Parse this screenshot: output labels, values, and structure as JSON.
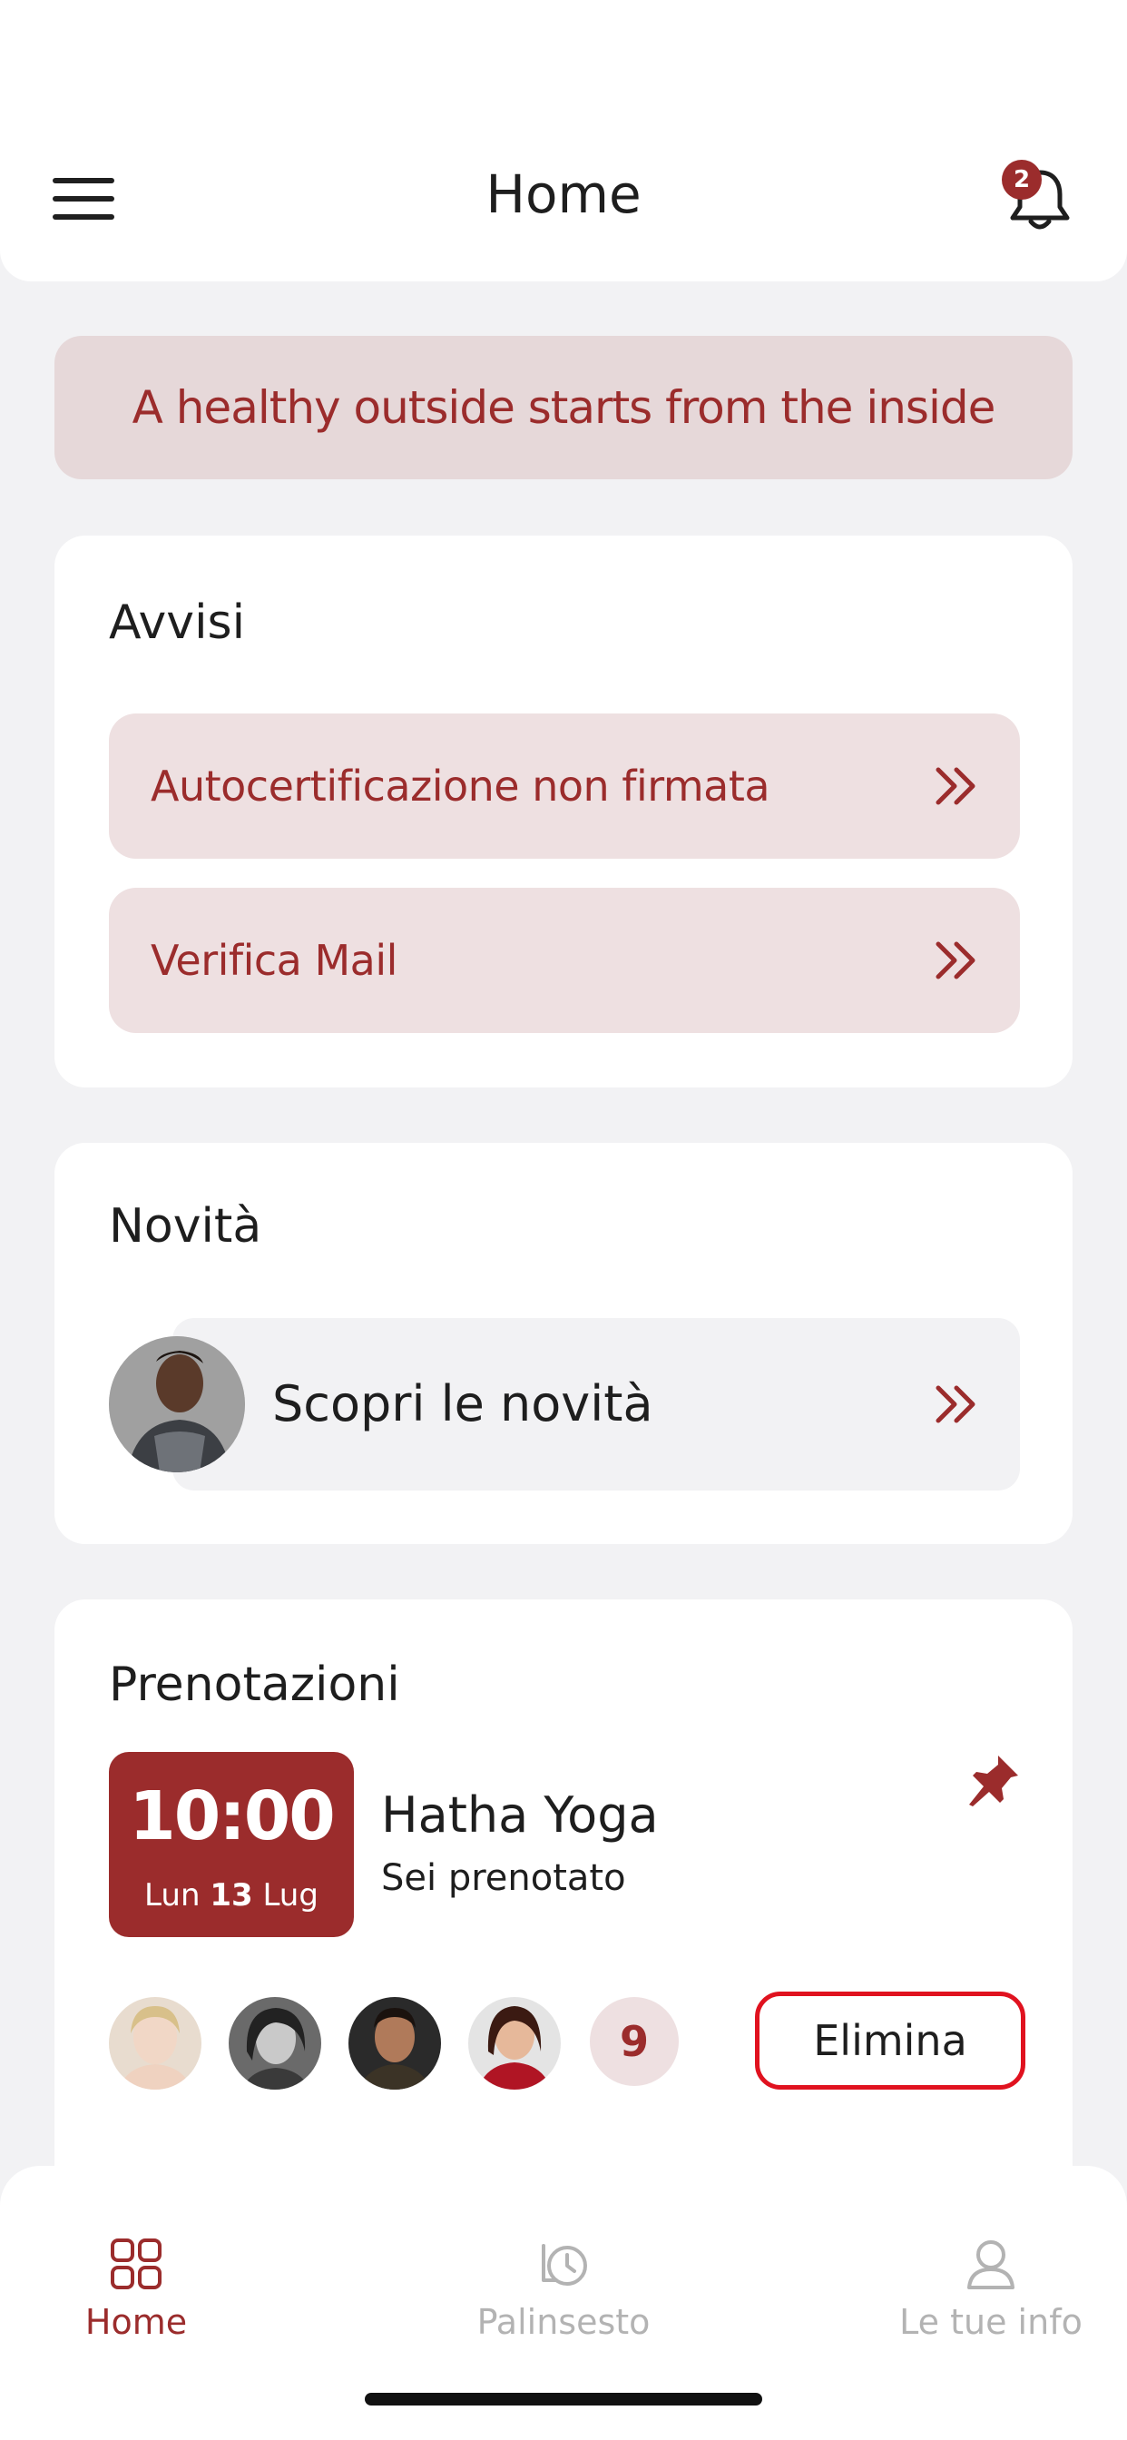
{
  "header": {
    "title": "Home",
    "notification_count": "2"
  },
  "motto": "A healthy outside starts from the inside",
  "alerts": {
    "title": "Avvisi",
    "items": [
      {
        "label": "Autocertificazione non firmata"
      },
      {
        "label": "Verifica Mail"
      }
    ]
  },
  "news": {
    "title": "Novità",
    "label": "Scopri le novità"
  },
  "bookings": {
    "title": "Prenotazioni",
    "time": "10:00",
    "day_name": "Lun",
    "day_number": "13",
    "month": "Lug",
    "class_name": "Hatha Yoga",
    "status": "Sei prenotato",
    "participants_extra": "9",
    "delete_label": "Elimina"
  },
  "tabbar": {
    "items": [
      {
        "label": "Home",
        "icon": "grid-icon",
        "active": true
      },
      {
        "label": "Palinsesto",
        "icon": "history-icon",
        "active": false
      },
      {
        "label": "Le tue info",
        "icon": "user-icon",
        "active": false
      }
    ]
  },
  "colors": {
    "accent": "#9b2c2c",
    "alert_bg": "#eee0e1",
    "background": "#f2f2f4",
    "delete_border": "#e0121f"
  }
}
